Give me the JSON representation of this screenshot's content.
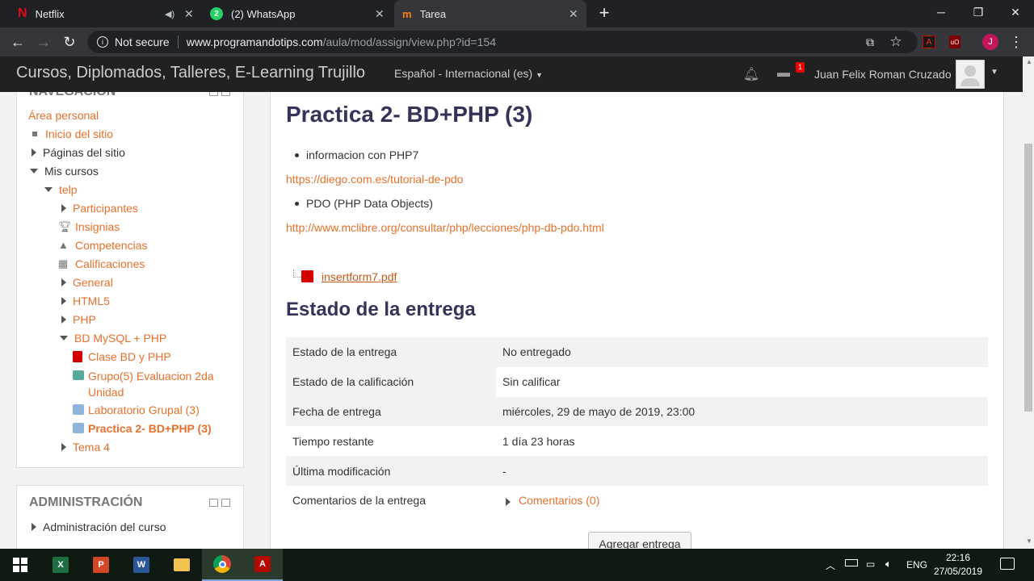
{
  "browser": {
    "tabs": [
      {
        "title": "Netflix",
        "icon": "netflix-icon"
      },
      {
        "title": "(2) WhatsApp",
        "icon": "whatsapp-icon",
        "badge": "2"
      },
      {
        "title": "Tarea",
        "icon": "moodle-icon"
      }
    ],
    "security": "Not secure",
    "url_host": "www.programandotips.com",
    "url_path": "/aula/mod/assign/view.php?id=154",
    "profile_initial": "J"
  },
  "site": {
    "title": "Cursos, Diplomados, Talleres, E-Learning Trujillo",
    "language": "Español - Internacional (es)",
    "message_count": "1",
    "user_name": "Juan Felix Roman Cruzado"
  },
  "sidebar": {
    "nav_title": "NAVEGACIÓN",
    "area_personal": "Área personal",
    "items": [
      {
        "label": "Inicio del sitio"
      },
      {
        "label": "Páginas del sitio"
      },
      {
        "label": "Mis cursos"
      },
      {
        "label": "telp"
      },
      {
        "label": "Participantes"
      },
      {
        "label": "Insignias"
      },
      {
        "label": "Competencias"
      },
      {
        "label": "Calificaciones"
      },
      {
        "label": "General"
      },
      {
        "label": "HTML5"
      },
      {
        "label": "PHP"
      },
      {
        "label": "BD MySQL + PHP"
      },
      {
        "label": "Clase BD y PHP"
      },
      {
        "label": "Grupo(5) Evaluacion 2da Unidad"
      },
      {
        "label": "Laboratorio Grupal (3)"
      },
      {
        "label": "Practica 2- BD+PHP (3)"
      },
      {
        "label": "Tema 4"
      }
    ],
    "admin_title": "ADMINISTRACIÓN",
    "admin_item": "Administración del curso"
  },
  "main": {
    "title": "Practica 2- BD+PHP (3)",
    "bullet1": "informacion con PHP7",
    "link1": "https://diego.com.es/tutorial-de-pdo",
    "bullet2": "PDO (PHP Data Objects)",
    "link2": "http://www.mclibre.org/consultar/php/lecciones/php-db-pdo.html",
    "file": "insertform7.pdf",
    "status_heading": "Estado de la entrega",
    "rows": [
      {
        "label": "Estado de la entrega",
        "value": "No entregado"
      },
      {
        "label": "Estado de la calificación",
        "value": "Sin calificar"
      },
      {
        "label": "Fecha de entrega",
        "value": "miércoles, 29 de mayo de 2019, 23:00"
      },
      {
        "label": "Tiempo restante",
        "value": "1 día 23 horas"
      },
      {
        "label": "Última modificación",
        "value": "-"
      },
      {
        "label": "Comentarios de la entrega",
        "value": "Comentarios (0)"
      }
    ],
    "submit_button": "Agregar entrega"
  },
  "taskbar": {
    "lang": "ENG",
    "time": "22:16",
    "date": "27/05/2019"
  },
  "colors": {
    "accent": "#e8702b",
    "heading": "#34345a"
  }
}
